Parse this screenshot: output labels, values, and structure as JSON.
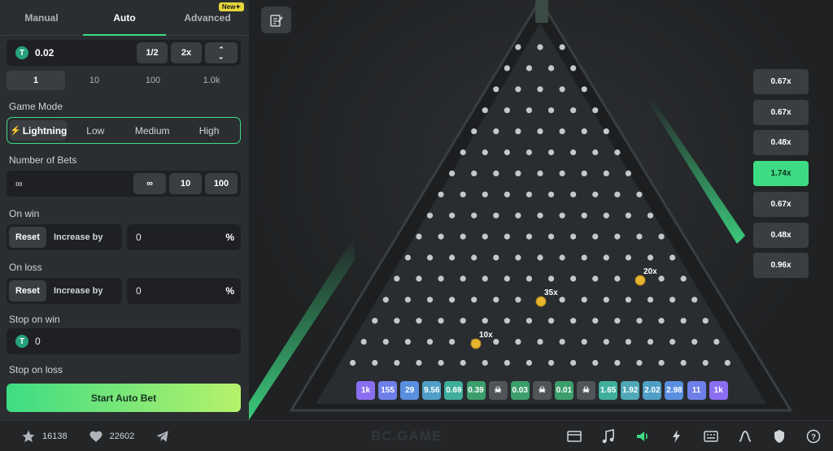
{
  "tabs": [
    {
      "label": "Manual",
      "active": false
    },
    {
      "label": "Auto",
      "active": true
    },
    {
      "label": "Advanced",
      "active": false,
      "badge": "New"
    }
  ],
  "bet_amount": {
    "value": "0.02",
    "half_label": "1/2",
    "double_label": "2x",
    "currency_icon": "tether-coin-icon",
    "currency_symbol": "T"
  },
  "presets": [
    {
      "label": "1",
      "active": true
    },
    {
      "label": "10",
      "active": false
    },
    {
      "label": "100",
      "active": false
    },
    {
      "label": "1.0k",
      "active": false
    }
  ],
  "game_mode": {
    "label": "Game Mode",
    "options": [
      {
        "label": "Lightning",
        "active": true
      },
      {
        "label": "Low",
        "active": false
      },
      {
        "label": "Medium",
        "active": false
      },
      {
        "label": "High",
        "active": false
      }
    ]
  },
  "number_of_bets": {
    "label": "Number of Bets",
    "value": "∞",
    "opt_inf": "∞",
    "opt_10": "10",
    "opt_100": "100"
  },
  "on_win": {
    "label": "On win",
    "reset_label": "Reset",
    "increase_label": "Increase by",
    "value": "0",
    "unit": "%"
  },
  "on_loss": {
    "label": "On loss",
    "reset_label": "Reset",
    "increase_label": "Increase by",
    "value": "0",
    "unit": "%"
  },
  "stop_on_win": {
    "label": "Stop on win",
    "value": "0"
  },
  "stop_on_loss": {
    "label": "Stop on loss"
  },
  "start_button": "Start Auto Bet",
  "history": [
    "0.67x",
    "0.67x",
    "0.48x",
    "1.74x",
    "0.67x",
    "0.48x",
    "0.96x"
  ],
  "history_highlight_index": 3,
  "buckets": [
    {
      "label": "1k",
      "color": "#8b6ef0"
    },
    {
      "label": "155",
      "color": "#6f7fe8"
    },
    {
      "label": "29",
      "color": "#5a8fe0"
    },
    {
      "label": "9.56",
      "color": "#4f9ec6"
    },
    {
      "label": "0.69",
      "color": "#3faf9c"
    },
    {
      "label": "0.39",
      "color": "#3b9e6c"
    },
    {
      "label": "☠",
      "color": "#505458"
    },
    {
      "label": "0.03",
      "color": "#3b9e6c"
    },
    {
      "label": "☠",
      "color": "#505458"
    },
    {
      "label": "0.01",
      "color": "#3b9e6c"
    },
    {
      "label": "☠",
      "color": "#505458"
    },
    {
      "label": "1.65",
      "color": "#3faf9c"
    },
    {
      "label": "1.92",
      "color": "#4fa8b8"
    },
    {
      "label": "2.02",
      "color": "#4f9ec6"
    },
    {
      "label": "2.98",
      "color": "#5a8fe0"
    },
    {
      "label": "11",
      "color": "#6f7fe8"
    },
    {
      "label": "1k",
      "color": "#8b6ef0"
    }
  ],
  "balls": [
    {
      "label": "20x"
    },
    {
      "label": "35x"
    },
    {
      "label": "10x"
    }
  ],
  "footer": {
    "stars": "16138",
    "likes": "22602",
    "brand": "BC.GAME"
  },
  "colors": {
    "accent": "#3ddc84",
    "panel": "#2b2e31",
    "field": "#1e2023"
  }
}
